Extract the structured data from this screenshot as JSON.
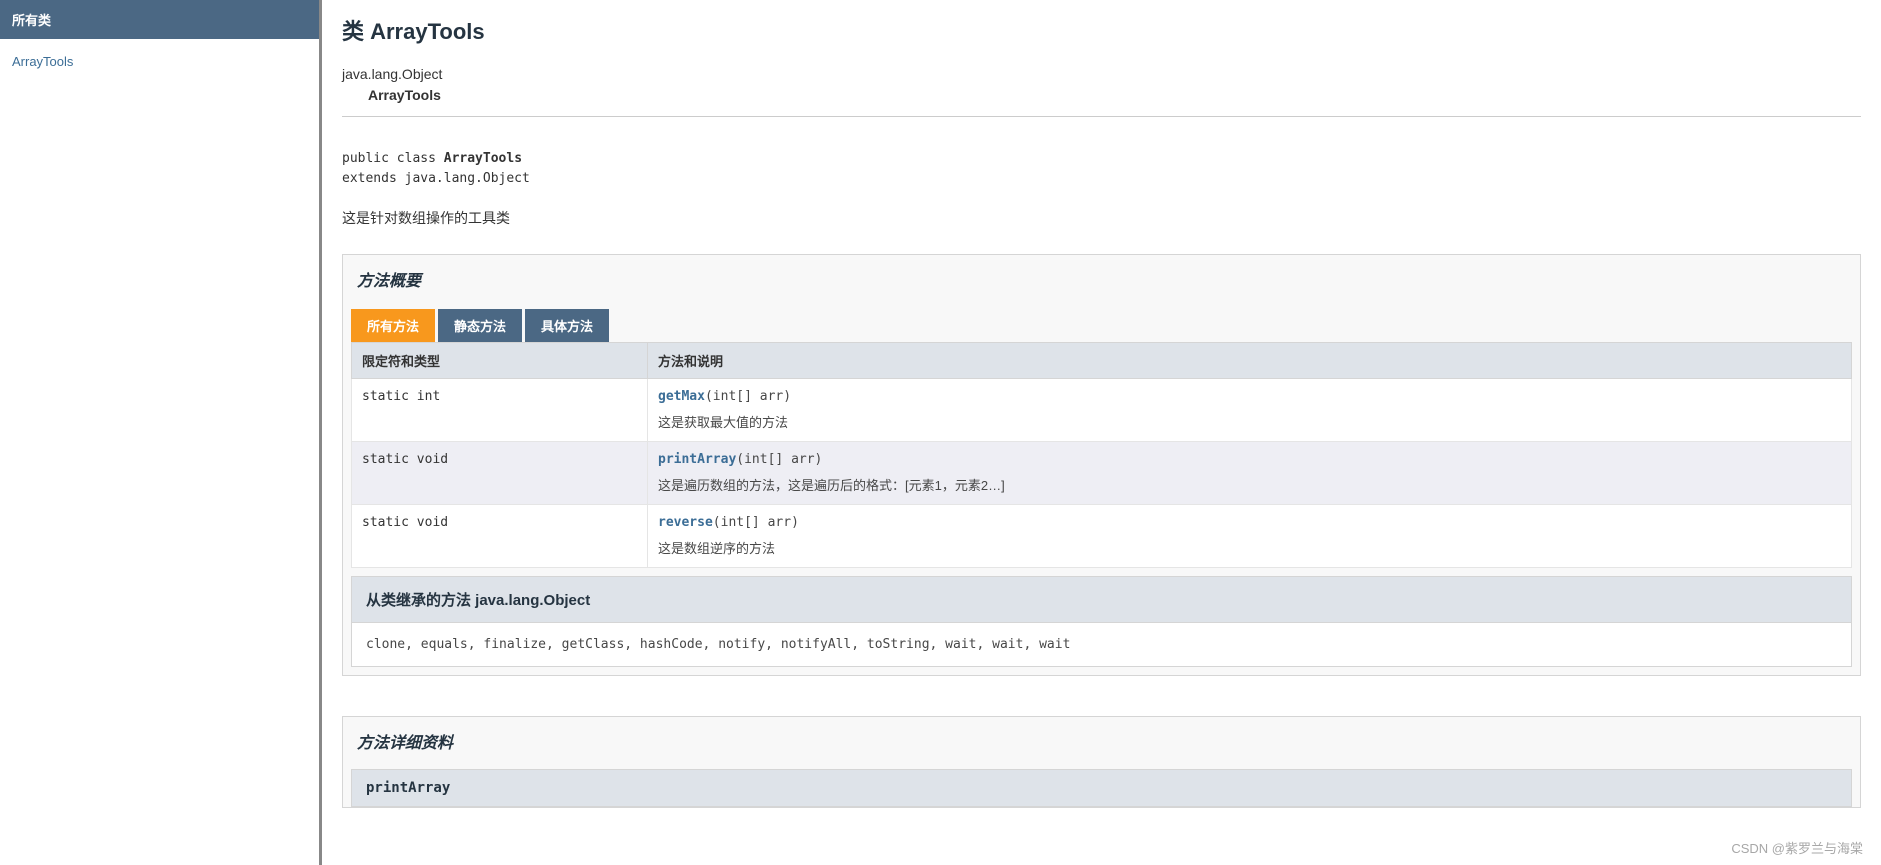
{
  "sidebar": {
    "title": "所有类",
    "items": [
      "ArrayTools"
    ]
  },
  "page": {
    "title": "类 ArrayTools",
    "hierarchy_root": "java.lang.Object",
    "hierarchy_leaf": "ArrayTools",
    "decl_prefix": "public class ",
    "decl_name": "ArrayTools",
    "decl_extends": "extends java.lang.Object",
    "description": "这是针对数组操作的工具类"
  },
  "methodSummary": {
    "title": "方法概要",
    "tabs": [
      "所有方法",
      "静态方法",
      "具体方法"
    ],
    "headers": [
      "限定符和类型",
      "方法和说明"
    ],
    "rows": [
      {
        "modifier": "static int",
        "name": "getMax",
        "sig": "(int[]  arr)",
        "desc": "这是获取最大值的方法"
      },
      {
        "modifier": "static void",
        "name": "printArray",
        "sig": "(int[]  arr)",
        "desc": "这是遍历数组的方法，这是遍历后的格式：[元素1，元素2…]"
      },
      {
        "modifier": "static void",
        "name": "reverse",
        "sig": "(int[]  arr)",
        "desc": "这是数组逆序的方法"
      }
    ],
    "inherit_title": "从类继承的方法 java.lang.Object",
    "inherit_list": "clone, equals, finalize, getClass, hashCode, notify, notifyAll, toString, wait, wait, wait"
  },
  "methodDetail": {
    "title": "方法详细资料",
    "first": "printArray"
  },
  "watermark": "CSDN @紫罗兰与海棠"
}
